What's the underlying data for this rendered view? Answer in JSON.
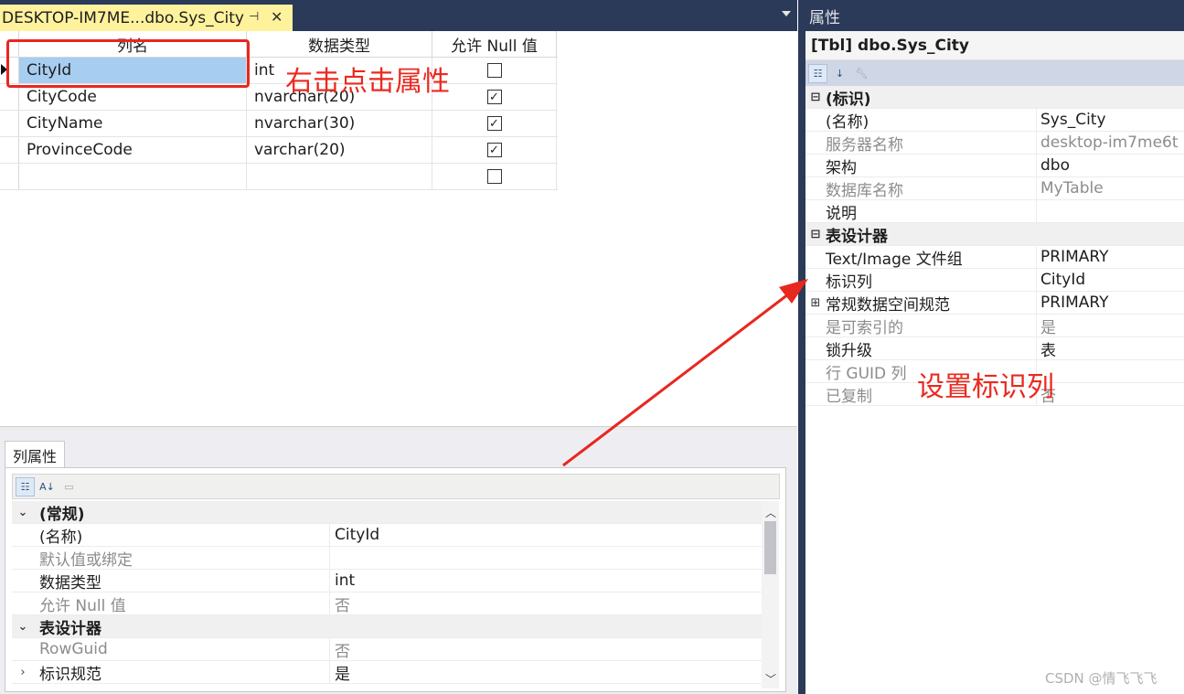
{
  "document_tab": {
    "title": "DESKTOP-IM7ME...dbo.Sys_City"
  },
  "table_grid": {
    "headers": [
      "列名",
      "数据类型",
      "允许 Null 值"
    ],
    "rows": [
      {
        "name": "CityId",
        "type": "int",
        "allow_null": false
      },
      {
        "name": "CityCode",
        "type": "nvarchar(20)",
        "allow_null": true
      },
      {
        "name": "CityName",
        "type": "nvarchar(30)",
        "allow_null": true
      },
      {
        "name": "ProvinceCode",
        "type": "varchar(20)",
        "allow_null": true
      },
      {
        "name": "",
        "type": "",
        "allow_null": false
      }
    ]
  },
  "annotations": {
    "right_click": "右击点击属性",
    "set_identity": "设置标识列",
    "color": "#e8271f"
  },
  "column_properties": {
    "tab_label": "列属性",
    "rows": [
      {
        "kind": "category",
        "expand": "⌄",
        "name": "(常规)",
        "value": ""
      },
      {
        "kind": "prop",
        "name": "(名称)",
        "value": "CityId",
        "gray": false
      },
      {
        "kind": "prop",
        "name": "默认值或绑定",
        "value": "",
        "gray": true
      },
      {
        "kind": "prop",
        "name": "数据类型",
        "value": "int",
        "gray": false
      },
      {
        "kind": "prop",
        "name": "允许 Null 值",
        "value": "否",
        "gray": true
      },
      {
        "kind": "category",
        "expand": "⌄",
        "name": "表设计器",
        "value": ""
      },
      {
        "kind": "prop",
        "name": "RowGuid",
        "value": "否",
        "gray": true
      },
      {
        "kind": "prop",
        "expand": "›",
        "name": "标识规范",
        "value": "是",
        "gray": false
      }
    ]
  },
  "properties_window": {
    "title": "属性",
    "object_title": "[Tbl] dbo.Sys_City",
    "rows": [
      {
        "kind": "category",
        "expand": "⊟",
        "name": "(标识)",
        "value": ""
      },
      {
        "kind": "prop",
        "name": "(名称)",
        "value": "Sys_City",
        "gray": false
      },
      {
        "kind": "prop",
        "name": "服务器名称",
        "value": "desktop-im7me6t",
        "gray": true
      },
      {
        "kind": "prop",
        "name": "架构",
        "value": "dbo",
        "gray": false
      },
      {
        "kind": "prop",
        "name": "数据库名称",
        "value": "MyTable",
        "gray": true
      },
      {
        "kind": "prop",
        "name": "说明",
        "value": "",
        "gray": false
      },
      {
        "kind": "category",
        "expand": "⊟",
        "name": "表设计器",
        "value": ""
      },
      {
        "kind": "prop",
        "name": "Text/Image 文件组",
        "value": "PRIMARY",
        "gray": false
      },
      {
        "kind": "prop",
        "name": "标识列",
        "value": "CityId",
        "gray": false
      },
      {
        "kind": "prop",
        "expand": "⊞",
        "name": "常规数据空间规范",
        "value": "PRIMARY",
        "gray": false
      },
      {
        "kind": "prop",
        "name": "是可索引的",
        "value": "是",
        "gray": true
      },
      {
        "kind": "prop",
        "name": "锁升级",
        "value": "表",
        "gray": false
      },
      {
        "kind": "prop",
        "name": "行 GUID 列",
        "value": "",
        "gray": true
      },
      {
        "kind": "prop",
        "name": "已复制",
        "value": "否",
        "gray": true
      }
    ]
  },
  "watermark": "CSDN @情飞飞飞"
}
